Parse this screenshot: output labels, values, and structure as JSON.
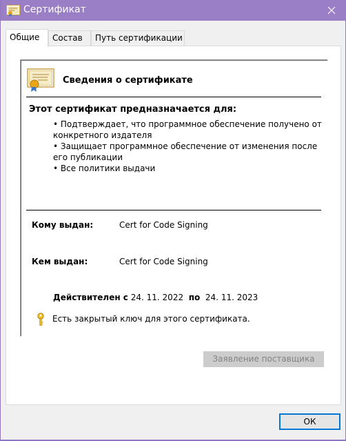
{
  "window": {
    "title": "Сертификат",
    "title_bar_color": "#9b7fc6"
  },
  "tabs": [
    {
      "label": "Общие",
      "active": true
    },
    {
      "label": "Состав",
      "active": false
    },
    {
      "label": "Путь сертификации",
      "active": false
    }
  ],
  "info": {
    "title": "Сведения о сертификате",
    "purpose_title": "Этот сертификат предназначается для:",
    "purposes": [
      "• Подтверждает, что программное обеспечение получено от конкретного издателя",
      "• Защищает программное обеспечение от  изменения после его публикации",
      "• Все политики выдачи"
    ],
    "issued_to_label": "Кому выдан:",
    "issued_to_value": "Cert for Code Signing",
    "issued_by_label": "Кем выдан:",
    "issued_by_value": "Cert for Code Signing",
    "valid_from_label": "Действителен с",
    "valid_from": "24. 11. 2022",
    "valid_to_label": "по",
    "valid_to": "24. 11. 2023",
    "private_key_text": "Есть закрытый ключ для этого сертификата."
  },
  "buttons": {
    "issuer_statement": "Заявление поставщика",
    "issuer_statement_enabled": false,
    "ok": "ОК"
  },
  "icons": {
    "window": "certificate-icon",
    "close": "close-icon",
    "cert": "certificate-icon",
    "key": "key-icon"
  }
}
